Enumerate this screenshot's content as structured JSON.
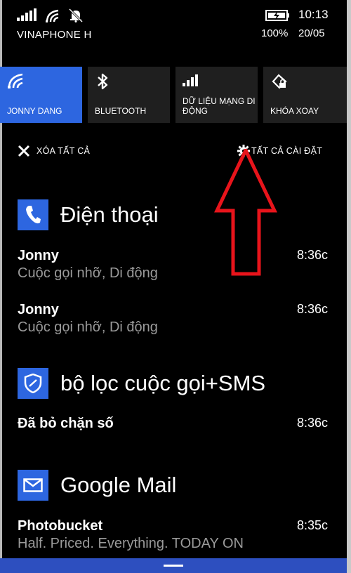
{
  "status_bar": {
    "carrier": "VINAPHONE H",
    "time": "10:13",
    "battery": "100%",
    "date": "20/05"
  },
  "quick_actions": [
    {
      "label": "JONNY DANG",
      "icon": "wifi-icon",
      "active": true
    },
    {
      "label": "BLUETOOTH",
      "icon": "bluetooth-icon",
      "active": false
    },
    {
      "label": "DỮ LIỆU MẠNG DI ĐỘNG",
      "icon": "cellular-data-icon",
      "active": false
    },
    {
      "label": "KHÓA XOAY",
      "icon": "rotation-lock-icon",
      "active": false
    }
  ],
  "actions": {
    "clear_all": "XÓA TẤT CẢ",
    "all_settings": "TẤT CẢ CÀI ĐẶT"
  },
  "groups": [
    {
      "app": "Điện thoại",
      "icon": "phone-icon",
      "items": [
        {
          "title": "Jonny",
          "text": "Cuộc gọi nhỡ, Di động",
          "time": "8:36c"
        },
        {
          "title": "Jonny",
          "text": "Cuộc gọi nhỡ, Di động",
          "time": "8:36c"
        }
      ]
    },
    {
      "app": "bộ lọc cuộc gọi+SMS",
      "icon": "shield-icon",
      "items": [
        {
          "title": "Đã bỏ chặn số",
          "text": "",
          "time": "8:36c"
        }
      ]
    },
    {
      "app": "Google Mail",
      "icon": "mail-icon",
      "items": [
        {
          "title": "Photobucket",
          "text": "Half. Priced. Everything. TODAY ON",
          "time": "8:35c"
        }
      ]
    }
  ],
  "colors": {
    "accent": "#2d66e0",
    "tile_inactive": "#1f1f1f",
    "annotation_arrow": "#e8141b",
    "bottom_bar": "#2d4fbf"
  }
}
